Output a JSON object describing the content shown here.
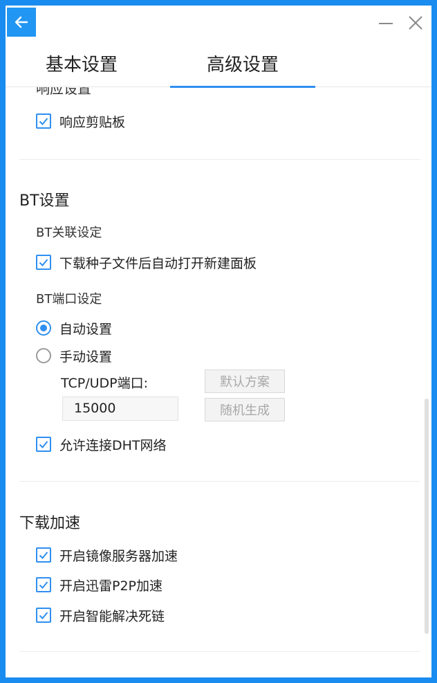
{
  "tabs": [
    {
      "label": "基本设置",
      "active": false
    },
    {
      "label": "高级设置",
      "active": true
    }
  ],
  "clipboard": {
    "title_partial": "响应设置",
    "respond_clipboard": {
      "label": "响应剪贴板",
      "checked": true
    }
  },
  "bt": {
    "title": "BT设置",
    "assoc_title": "BT关联设定",
    "auto_open": {
      "label": "下载种子文件后自动打开新建面板",
      "checked": true
    },
    "port_title": "BT端口设定",
    "auto_setting": {
      "label": "自动设置",
      "selected": true
    },
    "manual_setting": {
      "label": "手动设置",
      "selected": false
    },
    "port_label": "TCP/UDP端口:",
    "port_value": "15000",
    "default_btn": "默认方案",
    "random_btn": "随机生成",
    "dht": {
      "label": "允许连接DHT网络",
      "checked": true
    }
  },
  "accel": {
    "title": "下载加速",
    "mirror": {
      "label": "开启镜像服务器加速",
      "checked": true
    },
    "p2p": {
      "label": "开启迅雷P2P加速",
      "checked": true
    },
    "deadlink": {
      "label": "开启智能解决死链",
      "checked": true
    }
  },
  "icons": {
    "back": "arrow-left-icon",
    "minimize": "minimize-icon",
    "close": "close-icon",
    "check": "check-icon"
  },
  "colors": {
    "accent": "#2f8ff0",
    "frame": "#1a8cf0"
  }
}
